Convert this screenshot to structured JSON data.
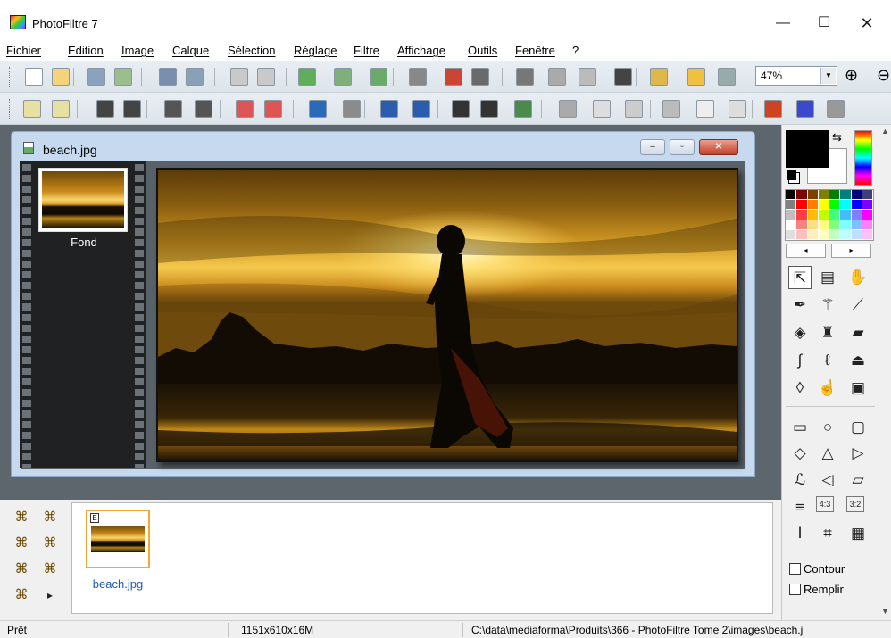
{
  "window": {
    "title": "PhotoFiltre 7",
    "minimize_glyph": "—",
    "maximize_glyph": "☐",
    "close_glyph": "✕"
  },
  "menu": [
    {
      "label": "Fichier"
    },
    {
      "label": "Edition"
    },
    {
      "label": "Image"
    },
    {
      "label": "Calque"
    },
    {
      "label": "Sélection"
    },
    {
      "label": "Réglage"
    },
    {
      "label": "Filtre"
    },
    {
      "label": "Affichage"
    },
    {
      "label": "Outils"
    },
    {
      "label": "Fenêtre"
    },
    {
      "label": "?"
    }
  ],
  "toolbar1": {
    "icons": [
      "new-file-icon",
      "open-folder-icon",
      "save-icon",
      "import-icon",
      "print-icon",
      "scanner-icon",
      "undo-icon",
      "redo-icon",
      "copy-image-icon",
      "paste-icon",
      "paste-new-icon",
      "fade-icon",
      "color-mode-icon",
      "image-size-icon",
      "canvas-size-icon",
      "crop-icon",
      "select-icon",
      "text-icon",
      "layer-icon",
      "plugin-icon",
      "window-icon"
    ],
    "zoom_value": "47%",
    "zoom_in_glyph": "⊕",
    "zoom_out_glyph": "⊖"
  },
  "toolbar2": {
    "icons": [
      "brightness-down-icon",
      "brightness-up-icon",
      "contrast-down-icon",
      "contrast-up-icon",
      "gamma-down-icon",
      "gamma-up-icon",
      "saturation-down-icon",
      "saturation-up-icon",
      "histogram-icon",
      "levels-icon",
      "auto-gamma-icon",
      "auto-contrast-icon",
      "grid-filter-icon",
      "grid-dark-icon",
      "grid-green-icon",
      "soften-icon",
      "drop-icon",
      "drop-dark-icon",
      "sharpen-icon",
      "triangle-icon",
      "triangle-outline-icon",
      "frame-icon",
      "outline-icon",
      "effect-icon"
    ]
  },
  "document": {
    "title": "beach.jpg",
    "min_glyph": "–",
    "max_glyph": "▫",
    "close_glyph": "✕"
  },
  "layers": [
    {
      "label": "Fond"
    }
  ],
  "tools": {
    "swap_glyph": "⇆",
    "palette_colors": [
      "#000000",
      "#7f0000",
      "#7f3f00",
      "#7f7f00",
      "#007f00",
      "#007f7f",
      "#00007f",
      "#3f3f7f",
      "#7f7f7f",
      "#ff0000",
      "#ff7f00",
      "#ffff00",
      "#00ff00",
      "#00ffff",
      "#0000ff",
      "#7f00ff",
      "#bfbfbf",
      "#ff3f3f",
      "#ffbf00",
      "#bfff00",
      "#3fff7f",
      "#3fbfff",
      "#7f7fff",
      "#ff00ff",
      "#ffffff",
      "#ff7f7f",
      "#ffdf7f",
      "#ffff7f",
      "#7fff7f",
      "#7fffff",
      "#7fbfff",
      "#ff7fff",
      "#dfdfdf",
      "#ffbfbf",
      "#ffefbf",
      "#ffffbf",
      "#bfffbf",
      "#bfffff",
      "#bfdfff",
      "#ffbfff"
    ],
    "palette_left": "◂",
    "palette_right": "▸",
    "items": [
      {
        "icon": "arrow-pointer-icon",
        "glyph": "⇱"
      },
      {
        "icon": "picture-frame-icon",
        "glyph": "▤"
      },
      {
        "icon": "hand-icon",
        "glyph": "✋"
      },
      {
        "icon": "eyedropper-icon",
        "glyph": "✒"
      },
      {
        "icon": "magic-wand-icon",
        "glyph": "⚚"
      },
      {
        "icon": "line-icon",
        "glyph": "⟋"
      },
      {
        "icon": "fill-bucket-icon",
        "glyph": "◈"
      },
      {
        "icon": "spray-icon",
        "glyph": "♜"
      },
      {
        "icon": "eraser-icon",
        "glyph": "▰"
      },
      {
        "icon": "brush-icon",
        "glyph": "∫"
      },
      {
        "icon": "advanced-brush-icon",
        "glyph": "ℓ"
      },
      {
        "icon": "stamp-icon",
        "glyph": "⏏"
      },
      {
        "icon": "blur-drop-icon",
        "glyph": "◊"
      },
      {
        "icon": "smudge-finger-icon",
        "glyph": "☝"
      },
      {
        "icon": "clone-icon",
        "glyph": "▣"
      },
      {
        "icon": "rectangle-shape-icon",
        "glyph": "▭"
      },
      {
        "icon": "ellipse-shape-icon",
        "glyph": "○"
      },
      {
        "icon": "rounded-rect-shape-icon",
        "glyph": "▢"
      },
      {
        "icon": "diamond-shape-icon",
        "glyph": "◇"
      },
      {
        "icon": "triangle-shape-icon",
        "glyph": "△"
      },
      {
        "icon": "arrow-shape-icon",
        "glyph": "▷"
      },
      {
        "icon": "lasso-icon",
        "glyph": "ℒ"
      },
      {
        "icon": "polygon-lasso-icon",
        "glyph": "◁"
      },
      {
        "icon": "open-selection-icon",
        "glyph": "▱"
      },
      {
        "icon": "selection-all-icon",
        "glyph": "≡"
      },
      {
        "icon": "ratio-4-3-icon",
        "glyph": "4:3"
      },
      {
        "icon": "ratio-3-2-icon",
        "glyph": "3:2"
      },
      {
        "icon": "text-frame-icon",
        "glyph": "Ⅰ"
      },
      {
        "icon": "crop-marks-icon",
        "glyph": "⌗"
      },
      {
        "icon": "grid-frame-icon",
        "glyph": "▦"
      }
    ],
    "contour_label": "Contour",
    "fill_label": "Remplir"
  },
  "browser": {
    "tool_glyphs": [
      "⌘",
      "⌘",
      "⌘",
      "⌘",
      "⌘",
      "⌘",
      "⌘",
      "▸"
    ],
    "thumbnail_label": "beach.jpg",
    "thumbnail_badge": "E"
  },
  "status": {
    "state": "Prêt",
    "dimensions": "1151x610x16M",
    "path": "C:\\data\\mediaforma\\Produits\\366 - PhotoFiltre Tome 2\\images\\beach.j"
  }
}
